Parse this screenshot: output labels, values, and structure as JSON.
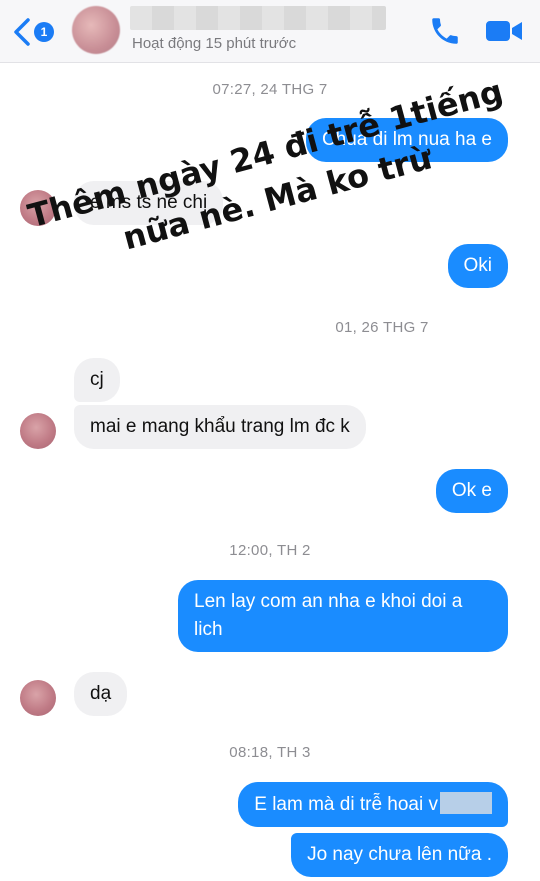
{
  "header": {
    "back_badge": "1",
    "status": "Hoạt động 15 phút trước"
  },
  "stamps": {
    "s1": "07:27, 24 THG 7",
    "s2": "01, 26 THG 7",
    "s3": "12:00, TH 2",
    "s4": "08:18, TH 3"
  },
  "messages": {
    "m1": "Chua di lm nua ha e",
    "m2": "e ms ts nè chị",
    "m3": "Oki",
    "m4": "cj",
    "m5": "mai e mang khẩu trang lm đc k",
    "m6": "Ok e",
    "m7": "Len lay com an nha e khoi doi a lich",
    "m8": "dạ",
    "m9": "E lam mà di trễ hoai v",
    "m10": "Jo nay chưa lên nữa ."
  },
  "overlay": {
    "line1": "Thêm ngày 24 đi trễ 1tiếng",
    "line2": "nữa nè. Mà ko trừ"
  },
  "colors": {
    "outgoing": "#1a8cff",
    "incoming": "#f0f0f2",
    "accent": "#1b7cf5"
  },
  "icons": {
    "back": "chevron-left-icon",
    "call": "phone-icon",
    "video": "video-camera-icon"
  }
}
